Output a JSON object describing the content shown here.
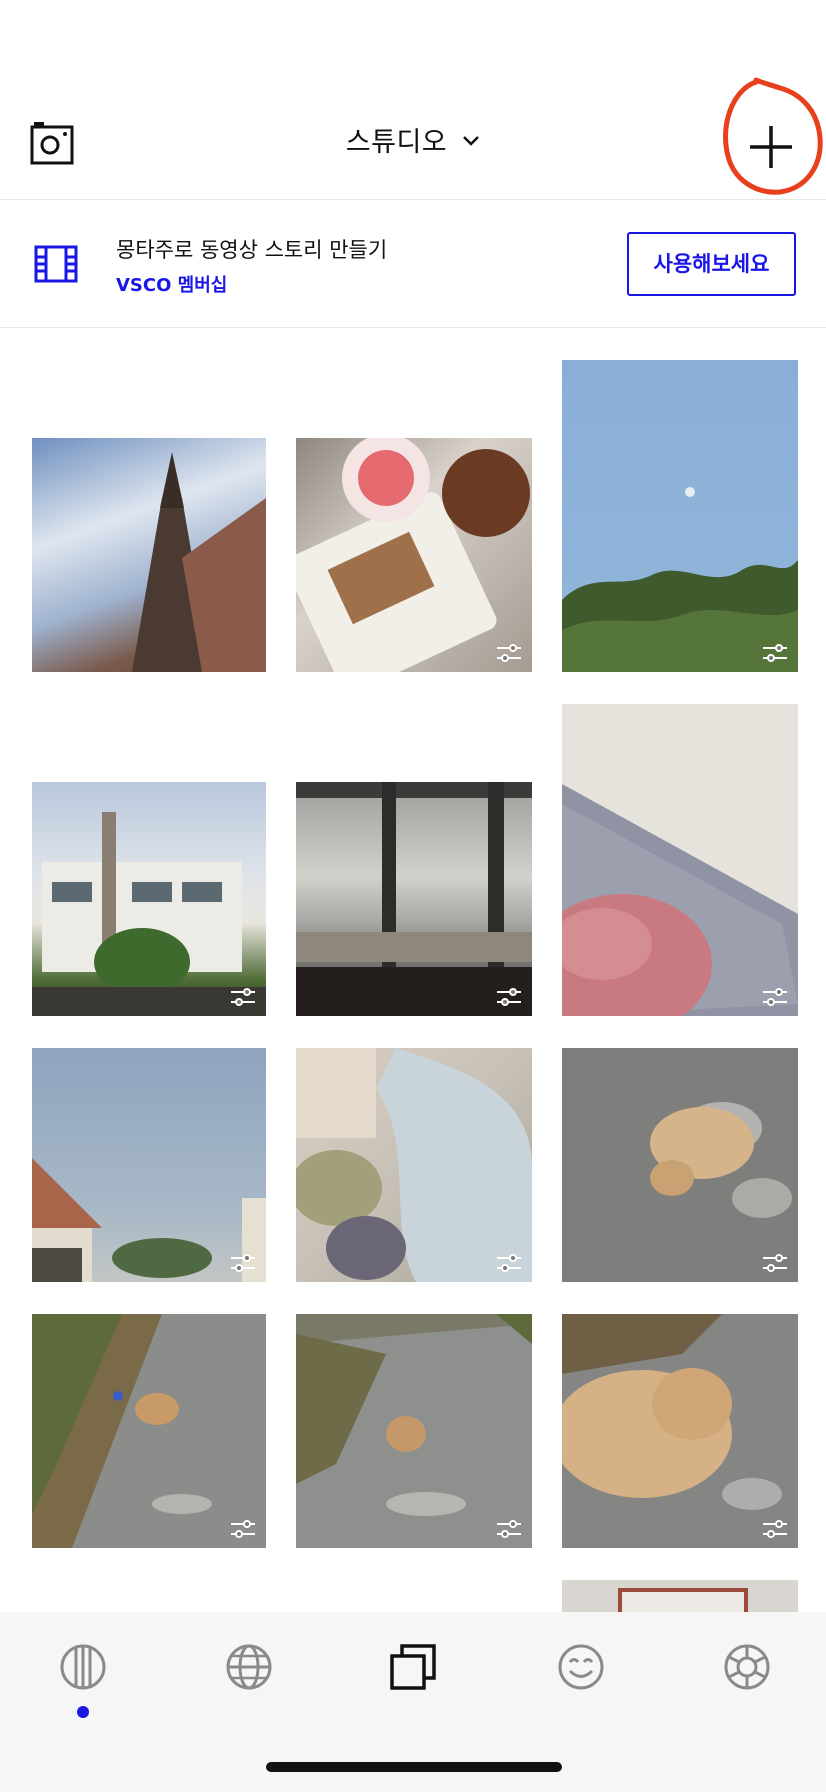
{
  "header": {
    "title": "스튜디오",
    "camera_icon": "camera-icon",
    "add_icon": "plus-icon",
    "chevron_icon": "chevron-down-icon"
  },
  "promo": {
    "icon": "film-strip-icon",
    "title": "몽타주로 동영상 스토리 만들기",
    "subtitle": "VSCO 멤버십",
    "button_label": "사용해보세요",
    "accent_color": "#1a17e6"
  },
  "photos": [
    {
      "name": "photo-church",
      "edited": false
    },
    {
      "name": "photo-cafe-desserts",
      "edited": true
    },
    {
      "name": "photo-sky-moon-pine",
      "edited": true
    },
    {
      "name": "photo-house",
      "edited": true
    },
    {
      "name": "photo-cafe-window-sea",
      "edited": true
    },
    {
      "name": "photo-blanket-pink",
      "edited": true
    },
    {
      "name": "photo-sky-roof",
      "edited": true
    },
    {
      "name": "photo-bed-pillows",
      "edited": true
    },
    {
      "name": "photo-dog-lying",
      "edited": true
    },
    {
      "name": "photo-dog-path-1",
      "edited": true
    },
    {
      "name": "photo-dog-path-2",
      "edited": true
    },
    {
      "name": "photo-dog-closeup",
      "edited": true
    },
    {
      "name": "photo-partial-frame",
      "edited": false
    }
  ],
  "nav": {
    "items": [
      "feed-icon",
      "globe-icon",
      "studio-icon",
      "smiley-icon",
      "aperture-icon"
    ],
    "active_index": 0
  }
}
